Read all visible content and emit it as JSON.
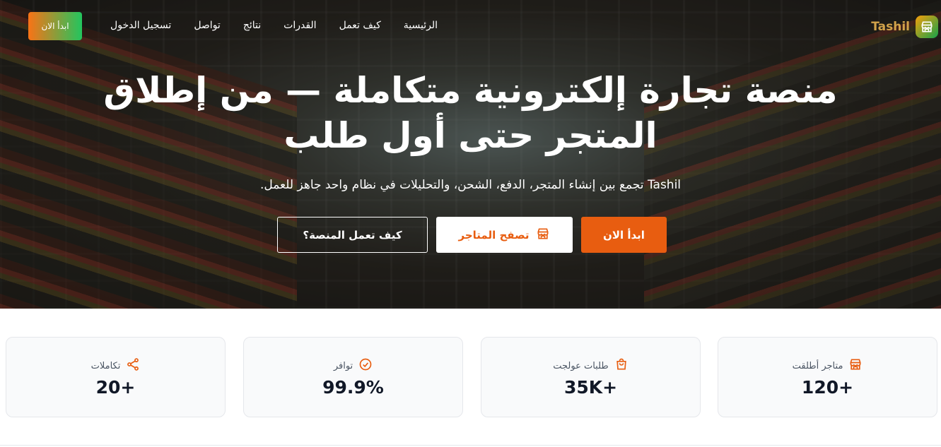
{
  "nav": {
    "brand": "Tashil",
    "links": [
      "الرئيسية",
      "كيف تعمل",
      "القدرات",
      "نتائج",
      "تواصل",
      "تسجيل الدخول"
    ],
    "cta": "ابدأ الان"
  },
  "hero": {
    "title_line1": "منصة تجارة إلكترونية متكاملة — من إطلاق",
    "title_line2": "المتجر حتى أول طلب",
    "subtitle": "Tashil تجمع بين إنشاء المتجر، الدفع، الشحن، والتحليلات في نظام واحد جاهز للعمل.",
    "primary_button": "ابدأ الان",
    "browse_button": "تصفح المتاجر",
    "how_button": "كيف تعمل المنصة؟"
  },
  "stats": [
    {
      "label": "متاجر أطلقت",
      "value": "120+",
      "icon": "store-icon"
    },
    {
      "label": "طلبات عولجت",
      "value": "35K+",
      "icon": "bag-icon"
    },
    {
      "label": "توافر",
      "value": "99.9%",
      "icon": "check-circle-icon"
    },
    {
      "label": "تكاملات",
      "value": "20+",
      "icon": "share-icon"
    }
  ],
  "colors": {
    "accent": "#e85d10",
    "brand_green": "#22c55e",
    "card_bg": "#f9fafb"
  }
}
